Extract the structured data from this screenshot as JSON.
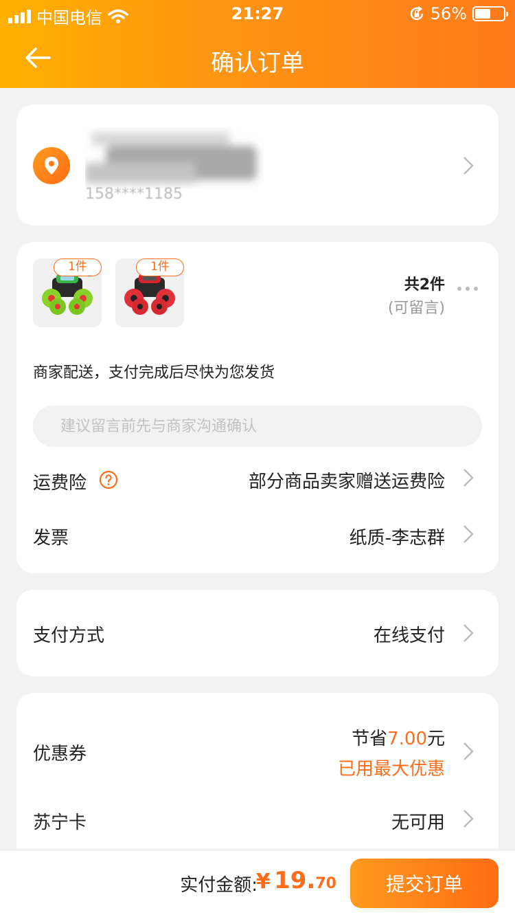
{
  "status_bar": {
    "carrier": "中国电信",
    "time": "21:27",
    "battery": "56%",
    "battery_level": 0.56,
    "icons": [
      "signal-icon",
      "wifi-icon",
      "orientation-lock-icon",
      "battery-icon"
    ]
  },
  "nav": {
    "title": "确认订单",
    "back_icon": "arrow-left-icon"
  },
  "address": {
    "icon": "location-pin-icon",
    "phone_masked": "158****1185"
  },
  "items": {
    "products": [
      {
        "qty_badge": "1件",
        "image": "green-monster-truck-toy"
      },
      {
        "qty_badge": "1件",
        "image": "red-monster-truck-toy"
      }
    ],
    "total_count": "共2件",
    "note_hint": "(可留言)",
    "delivery_text": "商家配送，支付完成后尽快为您发货",
    "message_placeholder": "建议留言前先与商家沟通确认",
    "shipping_insurance": {
      "label": "运费险",
      "value": "部分商品卖家赠送运费险"
    },
    "invoice": {
      "label": "发票",
      "value": "纸质-李志群"
    }
  },
  "payment": {
    "label": "支付方式",
    "value": "在线支付"
  },
  "discounts": {
    "coupon": {
      "label": "优惠券",
      "save_prefix": "节省",
      "save_amount": "7.00",
      "save_suffix": "元",
      "status": "已用最大优惠"
    },
    "suning_card": {
      "label": "苏宁卡",
      "value": "无可用"
    }
  },
  "footer": {
    "pay_label": "实付金额:",
    "currency": "¥",
    "amount_int": "19.",
    "amount_dec": "70",
    "submit_label": "提交订单"
  },
  "colors": {
    "accent": "#ff6d1a",
    "header_start": "#ffb000",
    "header_end": "#ff7a1a",
    "background": "#f2f2f2"
  }
}
